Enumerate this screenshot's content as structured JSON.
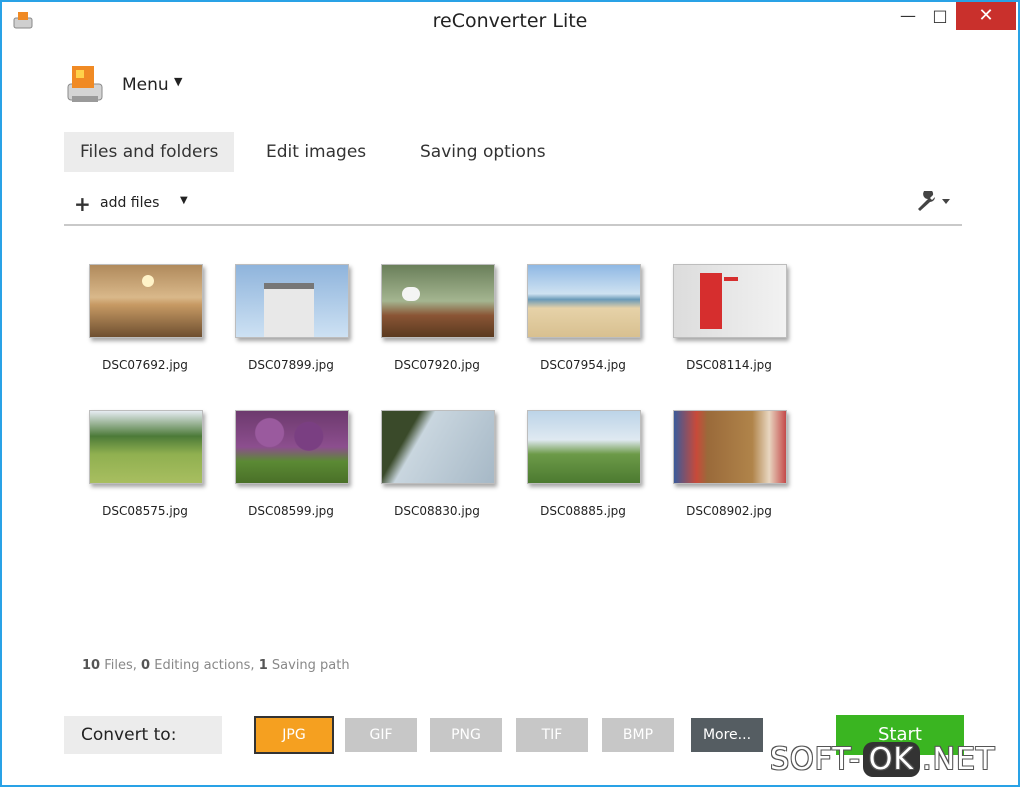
{
  "window": {
    "title": "reConverter Lite"
  },
  "menu": {
    "label": "Menu"
  },
  "tabs": [
    {
      "label": "Files and folders"
    },
    {
      "label": "Edit images"
    },
    {
      "label": "Saving options"
    }
  ],
  "toolbar": {
    "add_files_label": "add files"
  },
  "files": [
    {
      "name": "DSC07692.jpg"
    },
    {
      "name": "DSC07899.jpg"
    },
    {
      "name": "DSC07920.jpg"
    },
    {
      "name": "DSC07954.jpg"
    },
    {
      "name": "DSC08114.jpg"
    },
    {
      "name": "DSC08575.jpg"
    },
    {
      "name": "DSC08599.jpg"
    },
    {
      "name": "DSC08830.jpg"
    },
    {
      "name": "DSC08885.jpg"
    },
    {
      "name": "DSC08902.jpg"
    }
  ],
  "status": {
    "files_count": "10",
    "files_label": "Files,",
    "editing_count": "0",
    "editing_label": "Editing actions,",
    "saving_count": "1",
    "saving_label": "Saving path"
  },
  "convert": {
    "label": "Convert to:",
    "formats": [
      "JPG",
      "GIF",
      "PNG",
      "TIF",
      "BMP",
      "More..."
    ],
    "selected": "JPG"
  },
  "start_label": "Start",
  "watermark": {
    "part1": "SOFT-",
    "part2": "OK",
    "part3": ".NET"
  },
  "colors": {
    "accent": "#29a2e6",
    "selected_format": "#f5a020",
    "start": "#3ab521",
    "close": "#c9302c"
  }
}
